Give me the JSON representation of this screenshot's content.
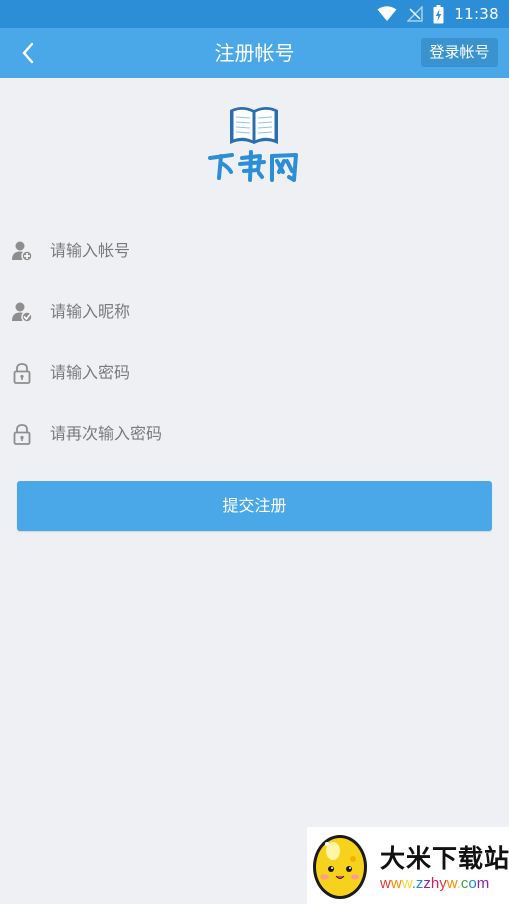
{
  "status_bar": {
    "time": "11:38",
    "icons": [
      "wifi-icon",
      "signal-off-icon",
      "battery-charging-icon"
    ]
  },
  "app_bar": {
    "back_icon": "chevron-left-icon",
    "title": "注册帐号",
    "login_label": "登录帐号"
  },
  "logo": {
    "icon": "open-book-icon",
    "text": "下书网"
  },
  "form": {
    "account_placeholder": "请输入帐号",
    "nickname_placeholder": "请输入昵称",
    "password_placeholder": "请输入密码",
    "confirm_password_placeholder": "请再次输入密码",
    "submit_label": "提交注册"
  },
  "watermark": {
    "title": "大米下载站",
    "url": "www.zzhyw.com"
  },
  "colors": {
    "status_bar": "#2b8ed6",
    "app_bar": "#4aa8e8",
    "login_button": "#3a93cf",
    "background": "#eff0f4",
    "submit_button": "#4aa8e8",
    "icon_gray": "#8e8e8e"
  }
}
